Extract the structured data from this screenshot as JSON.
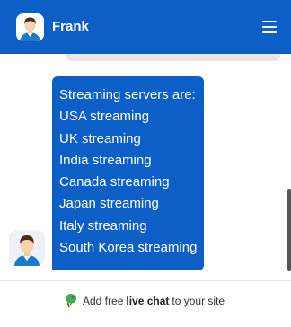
{
  "header": {
    "name": "Frank",
    "background": "#0b5fc7",
    "menu_icon": "hamburger-menu-icon",
    "avatar_icon": "agent-avatar-icon"
  },
  "chat": {
    "bot_message": {
      "lines": [
        "Streaming servers are:",
        "USA streaming",
        "UK streaming",
        "India streaming",
        "Canada streaming",
        "Japan streaming",
        "Italy streaming",
        "South Korea streaming"
      ],
      "bubble_color": "#0b5fc7"
    },
    "bot_avatar_icon": "agent-avatar-icon"
  },
  "footer": {
    "prefix": "Add free",
    "highlight": "live chat",
    "suffix": "to your site",
    "brand_icon": "livechat-brand-icon"
  }
}
